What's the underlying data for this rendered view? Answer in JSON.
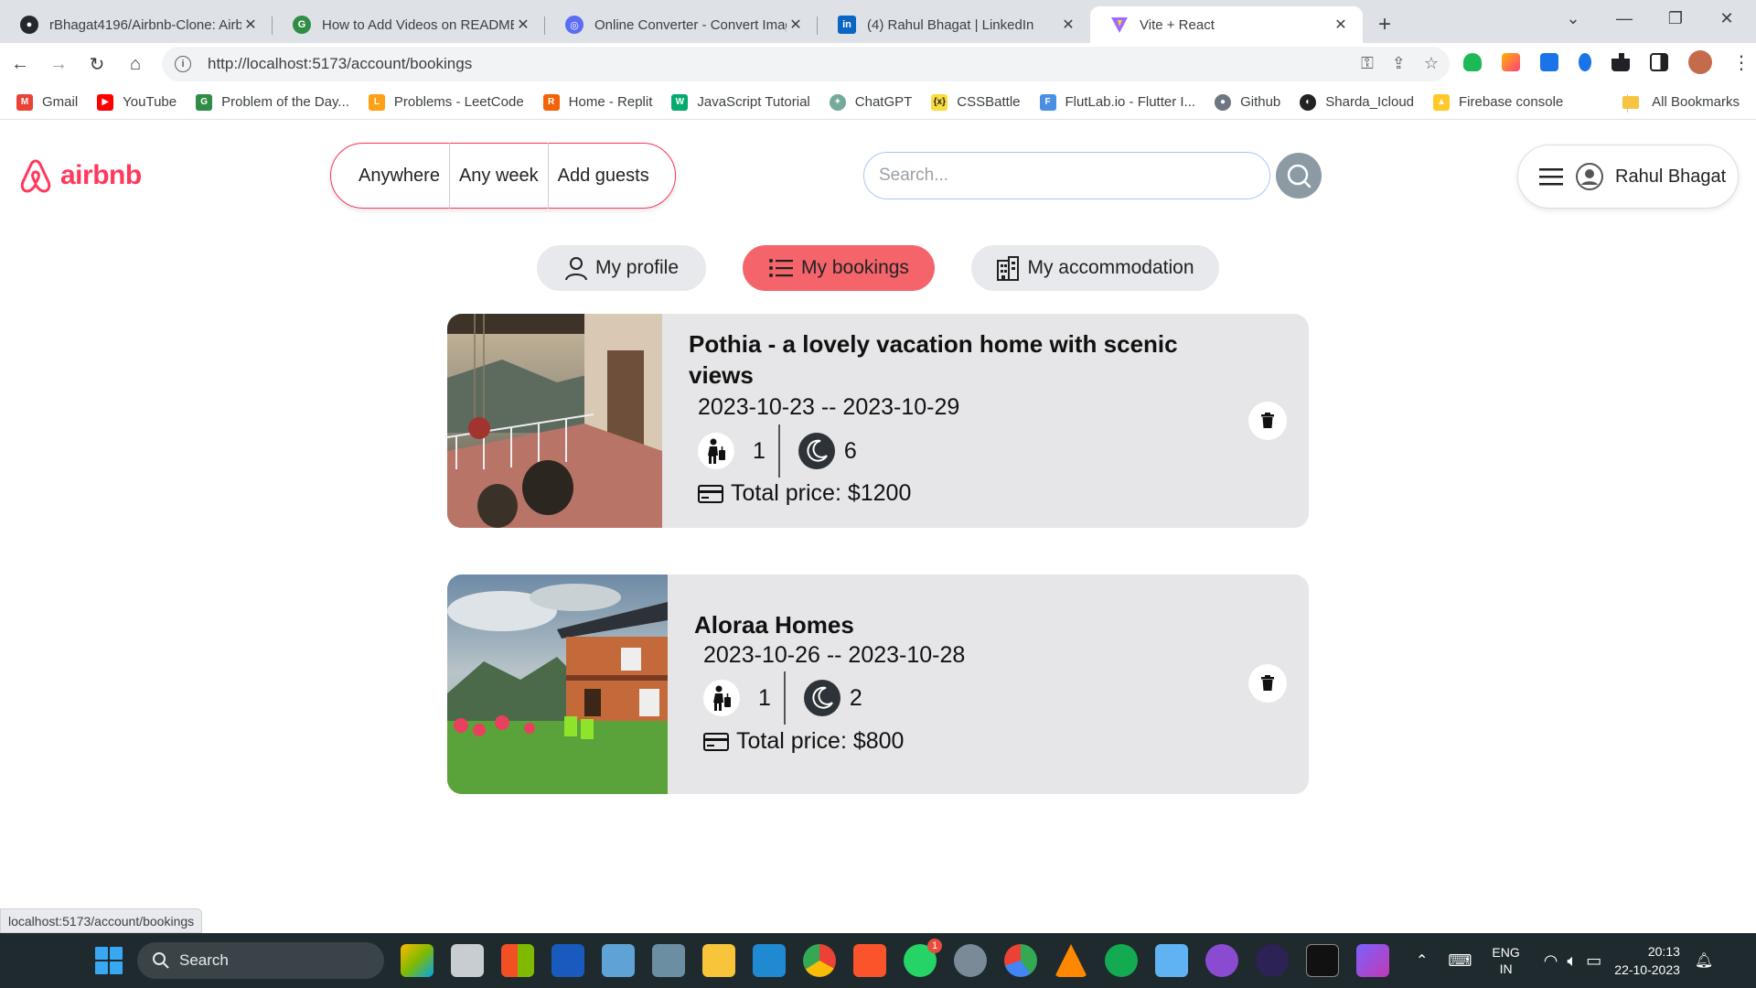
{
  "browser": {
    "tabs": [
      {
        "title": "rBhagat4196/Airbnb-Clone: Airb",
        "icon": "github-icon",
        "color": "#24292e"
      },
      {
        "title": "How to Add Videos on README",
        "icon": "geeksforgeeks-icon",
        "color": "#2f8d46"
      },
      {
        "title": "Online Converter - Convert Imag",
        "icon": "converter-icon",
        "color": "#5b6cf5"
      },
      {
        "title": "(4) Rahul Bhagat | LinkedIn",
        "icon": "linkedin-icon",
        "color": "#0a66c2"
      },
      {
        "title": "Vite + React",
        "icon": "vite-icon",
        "color": "#9d6bff"
      }
    ],
    "url": "http://localhost:5173/account/bookings",
    "bookmarks": [
      {
        "label": "Gmail",
        "color": "#ea4335"
      },
      {
        "label": "YouTube",
        "color": "#ff0000"
      },
      {
        "label": "Problem of the Day...",
        "color": "#2f8d46"
      },
      {
        "label": "Problems - LeetCode",
        "color": "#ffa116"
      },
      {
        "label": "Home - Replit",
        "color": "#f26207"
      },
      {
        "label": "JavaScript Tutorial",
        "color": "#04aa6d"
      },
      {
        "label": "ChatGPT",
        "color": "#74aa9c"
      },
      {
        "label": "CSSBattle",
        "color": "#f9dc3e"
      },
      {
        "label": "FlutLab.io - Flutter I...",
        "color": "#4a90e2"
      },
      {
        "label": "Github",
        "color": "#6e7681"
      },
      {
        "label": "Sharda_Icloud",
        "color": "#222222"
      },
      {
        "label": "Firebase console",
        "color": "#ffca28"
      }
    ],
    "all_bookmarks": "All Bookmarks",
    "status_url": "localhost:5173/account/bookings"
  },
  "header": {
    "logo_text": "airbnb",
    "filters": [
      "Anywhere",
      "Any week",
      "Add guests"
    ],
    "search_placeholder": "Search...",
    "user_name": "Rahul Bhagat"
  },
  "account_nav": [
    {
      "label": "My profile",
      "icon": "user-icon",
      "active": false
    },
    {
      "label": "My bookings",
      "icon": "list-icon",
      "active": true
    },
    {
      "label": "My accommodation",
      "icon": "building-icon",
      "active": false
    }
  ],
  "bookings": [
    {
      "title_line1": "Pothia - a lovely vacation home with scenic",
      "title_line2": "views",
      "dates": "2023-10-23 -- 2023-10-29",
      "guests": "1",
      "nights": "6",
      "price": "Total price: $1200"
    },
    {
      "title_line1": "Aloraa Homes",
      "title_line2": "",
      "dates": "2023-10-26 -- 2023-10-28",
      "guests": "1",
      "nights": "2",
      "price": "Total price: $800"
    }
  ],
  "taskbar": {
    "search_label": "Search",
    "lang_line1": "ENG",
    "lang_line2": "IN",
    "time": "20:13",
    "date": "22-10-2023",
    "notification_badge": "1"
  },
  "colors": {
    "brand": "#ff385c",
    "active_tab": "#f5646b",
    "card_bg": "#e6e6e8"
  }
}
